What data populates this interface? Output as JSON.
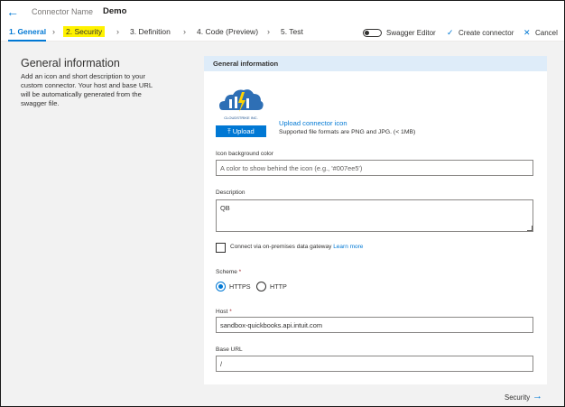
{
  "header": {
    "connector_label": "Connector Name",
    "connector_name": "Demo"
  },
  "tabs": [
    {
      "label": "1. General"
    },
    {
      "label": "2. Security"
    },
    {
      "label": "3. Definition"
    },
    {
      "label": "4. Code (Preview)"
    },
    {
      "label": "5. Test"
    }
  ],
  "toolbar": {
    "swagger_editor": "Swagger Editor",
    "create_connector": "Create connector",
    "cancel": "Cancel"
  },
  "intro": {
    "title": "General information",
    "description": "Add an icon and short description to your custom connector. Your host and base URL will be automatically generated from the swagger file."
  },
  "panel": {
    "header": "General information",
    "logo_text": "CLOUDSTRIKE INC.",
    "upload_button": "Upload",
    "upload_link": "Upload connector icon",
    "upload_hint": "Supported file formats are PNG and JPG. (< 1MB)",
    "icon_bg": {
      "label": "Icon background color",
      "placeholder": "A color to show behind the icon (e.g., '#007ee5')"
    },
    "description": {
      "label": "Description",
      "value": "QB"
    },
    "gateway": {
      "label": "Connect via on-premises data gateway",
      "link": "Learn more"
    },
    "scheme": {
      "label": "Scheme",
      "required": "*",
      "options": [
        "HTTPS",
        "HTTP"
      ],
      "selected": "HTTPS"
    },
    "host": {
      "label": "Host",
      "required": "*",
      "value": "sandbox-quickbooks.api.intuit.com"
    },
    "base_url": {
      "label": "Base URL",
      "value": "/"
    }
  },
  "footer": {
    "next_label": "Security"
  },
  "colors": {
    "accent": "#0078d4",
    "highlight": "#fff200",
    "panel_header": "#deecf9"
  }
}
